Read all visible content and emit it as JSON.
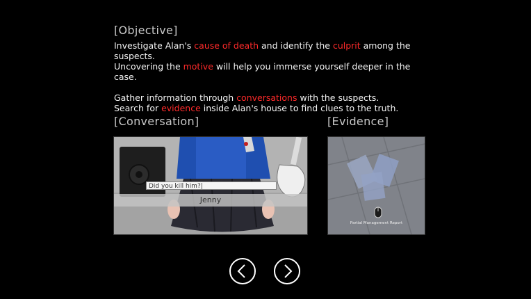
{
  "objective": {
    "heading": "[Objective]",
    "line1": {
      "t1": "Investigate Alan's ",
      "h1": "cause of death",
      "t2": " and identify the ",
      "h2": "culprit",
      "t3": " among the"
    },
    "line2": {
      "t1": "suspects."
    },
    "line3": {
      "t1": "Uncovering the ",
      "h1": "motive",
      "t2": " will help you immerse yourself deeper in the case."
    },
    "line4": {
      "t1": "Gather information through ",
      "h1": "conversations",
      "t2": " with the suspects."
    },
    "line5": {
      "t1": "Search for ",
      "h1": "evidence",
      "t2": " inside Alan's house to find clues to the truth."
    }
  },
  "conversation": {
    "heading": "[Conversation]",
    "input_value": "Did you kill him?|",
    "speaker_name": "Jenny"
  },
  "evidence": {
    "heading": "[Evidence]",
    "item_label": "Partial Management Report"
  },
  "colors": {
    "background": "#000000",
    "highlight": "#ff2a2a",
    "jacket": "#1f4fb0"
  },
  "icons": {
    "prev": "chevron-left-icon",
    "next": "chevron-right-icon",
    "mouse": "mouse-icon"
  }
}
